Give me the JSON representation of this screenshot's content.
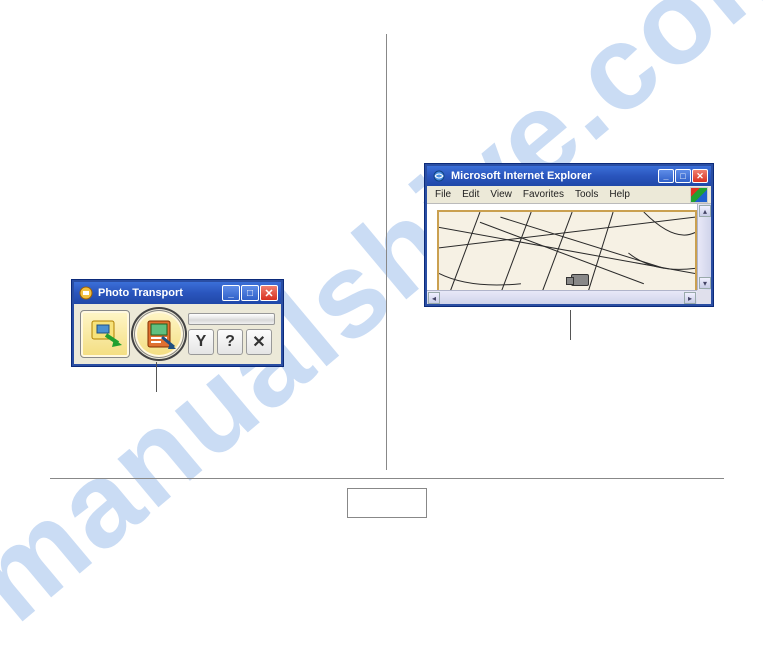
{
  "photo_transport": {
    "title": "Photo Transport",
    "icons": {
      "app": "photo-transport-icon",
      "transfer": "transfer-icon",
      "capture": "capture-icon",
      "settings": "Y",
      "help": "?",
      "close_tool": "✕"
    },
    "window_buttons": {
      "min": "_",
      "max": "□",
      "close": "✕"
    }
  },
  "ie": {
    "title": "Microsoft Internet Explorer",
    "menus": [
      "File",
      "Edit",
      "View",
      "Favorites",
      "Tools",
      "Help"
    ],
    "window_buttons": {
      "min": "_",
      "max": "□",
      "close": "✕"
    },
    "scroll": {
      "up": "▴",
      "down": "▾",
      "left": "◂",
      "right": "▸"
    }
  },
  "watermark": "manualshive.com"
}
